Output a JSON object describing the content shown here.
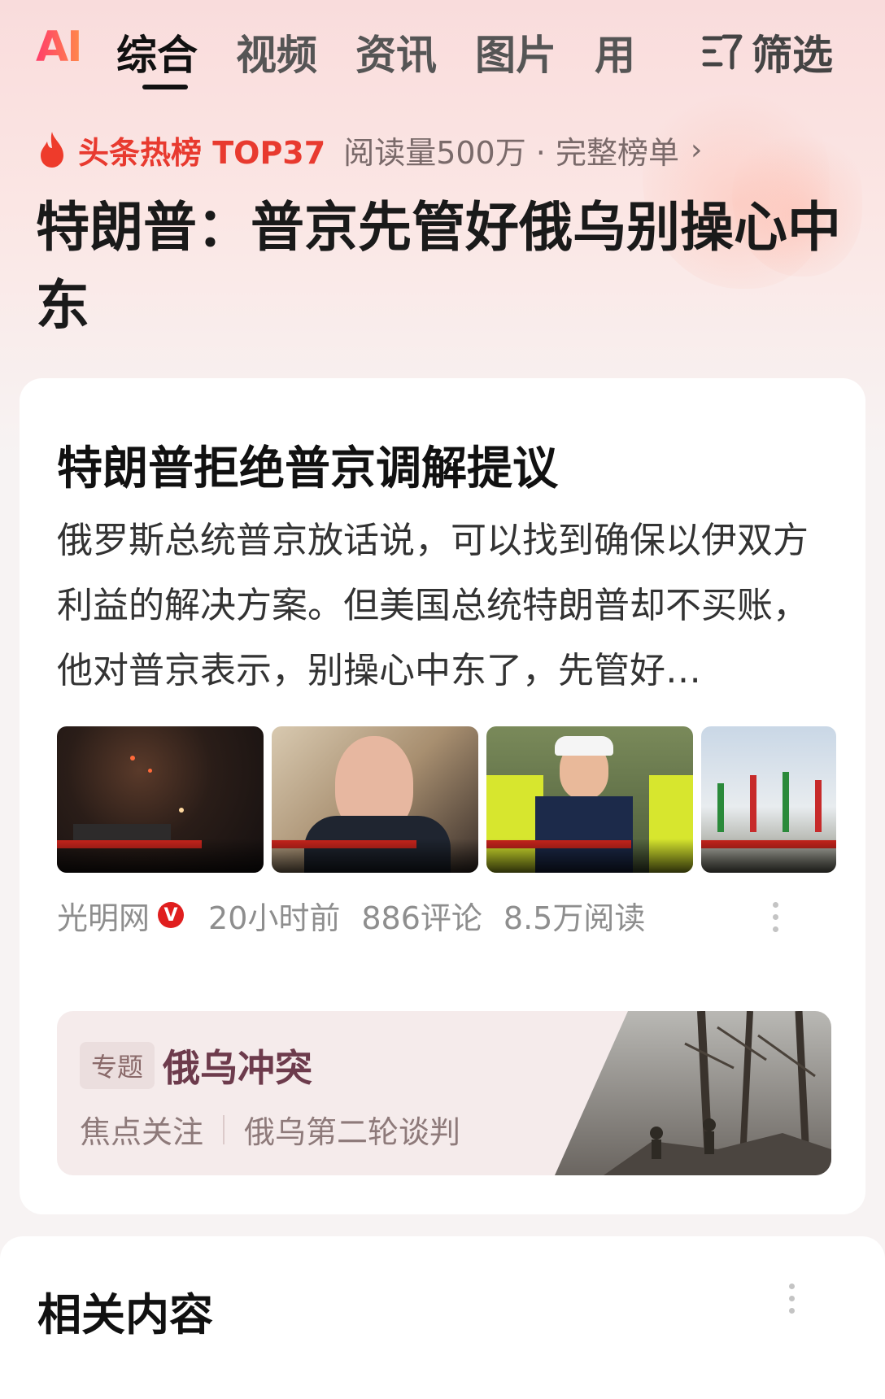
{
  "nav": {
    "ai_label": "AI",
    "tabs": [
      "综合",
      "视频",
      "资讯",
      "图片",
      "用"
    ],
    "active_tab": "综合",
    "filter_label": "筛选"
  },
  "hot": {
    "badge_title": "头条热榜 TOP37",
    "meta": "阅读量500万 · 完整榜单",
    "headline": "特朗普：普京先管好俄乌别操心中东"
  },
  "card": {
    "title": "特朗普拒绝普京调解提议",
    "summary": "俄罗斯总统普京放话说，可以找到确保以伊双方利益的解决方案。但美国总统特朗普却不买账，他对普京表示，别操心中东了，先管好…",
    "source": "光明网",
    "verified_badge": "V",
    "time": "20小时前",
    "comments": "886评论",
    "reads": "8.5万阅读",
    "thumbnails": [
      {
        "name": "night-strike-thumbnail"
      },
      {
        "name": "putin-thumbnail"
      },
      {
        "name": "trump-thumbnail"
      },
      {
        "name": "flags-thumbnail"
      }
    ]
  },
  "topic": {
    "tag": "专题",
    "name": "俄乌冲突",
    "links": [
      "焦点关注",
      "俄乌第二轮谈判"
    ]
  },
  "related": {
    "title": "相关内容"
  },
  "colors": {
    "accent_red": "#e83a2f",
    "topic_purple": "#6d3b4c",
    "badge_red": "#e01e1e"
  }
}
